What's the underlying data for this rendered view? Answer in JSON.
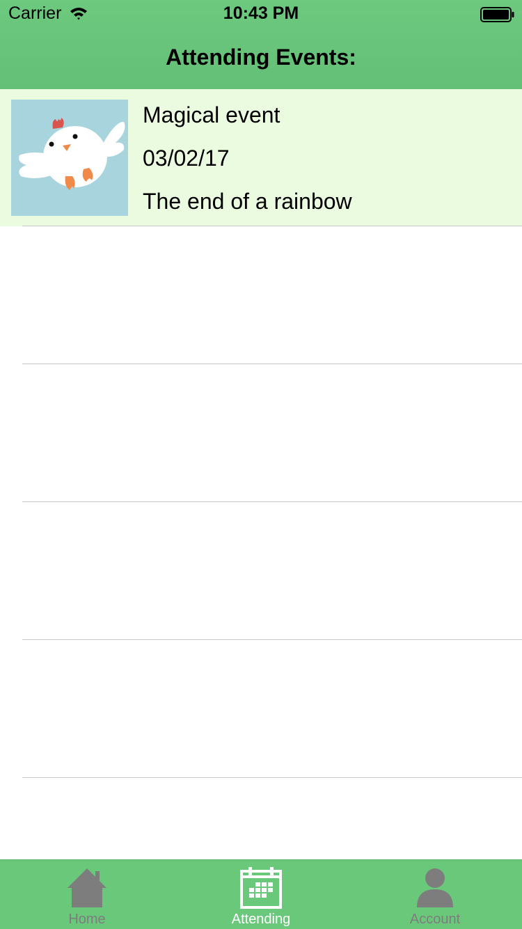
{
  "status_bar": {
    "carrier": "Carrier",
    "time": "10:43 PM"
  },
  "nav": {
    "title": "Attending Events:"
  },
  "events": [
    {
      "name": "Magical event",
      "date": "03/02/17",
      "location": "The end of a rainbow",
      "thumbnail_icon": "bird-icon"
    }
  ],
  "tabs": [
    {
      "label": "Home",
      "icon": "home-icon",
      "active": false
    },
    {
      "label": "Attending",
      "icon": "calendar-icon",
      "active": true
    },
    {
      "label": "Account",
      "icon": "person-icon",
      "active": false
    }
  ],
  "colors": {
    "header_green": "#6cc97e",
    "row_highlight": "#ebfbe0",
    "tab_active": "#ffffff",
    "tab_inactive": "#7d7d7d"
  }
}
